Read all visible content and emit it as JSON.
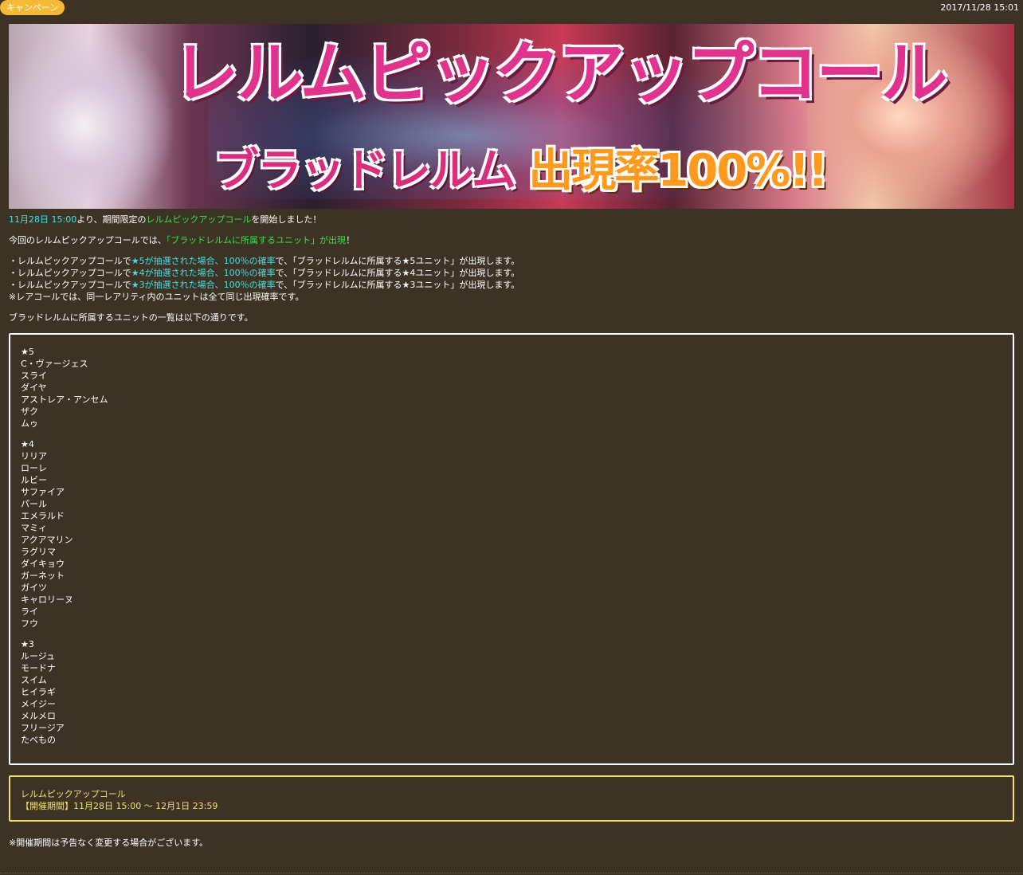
{
  "header": {
    "category": "キャンペーン",
    "date": "2017/11/28 15:01"
  },
  "banner": {
    "title": "レルムピックアップコール",
    "subtitle_main": "ブラッドレルム",
    "subtitle_rate": "出現率100%!!"
  },
  "intro": {
    "start_time": "11月28日 15:00",
    "text_a": "より、期間限定の",
    "event_name": "レルムピックアップコール",
    "text_b": "を開始しました！"
  },
  "highlight": {
    "text_a": "今回のレルムピックアップコールでは、",
    "emphasis": "「ブラッドレルムに所属するユニット」が出現",
    "text_b": "！"
  },
  "rules": [
    {
      "prefix": "・レルムピックアップコールで",
      "em": "★5が抽選された場合、100％の確率",
      "suffix": "で、「ブラッドレルムに所属する★5ユニット」が出現します。"
    },
    {
      "prefix": "・レルムピックアップコールで",
      "em": "★4が抽選された場合、100％の確率",
      "suffix": "で、「ブラッドレルムに所属する★4ユニット」が出現します。"
    },
    {
      "prefix": "・レルムピックアップコールで",
      "em": "★3が抽選された場合、100％の確率",
      "suffix": "で、「ブラッドレルムに所属する★3ユニット」が出現します。"
    }
  ],
  "note_rate": "※レアコールでは、同一レアリティ内のユニットは全て同じ出現確率です。",
  "list_intro": "ブラッドレルムに所属するユニットの一覧は以下の通りです。",
  "unit_groups": [
    {
      "rarity": "★5",
      "units": [
        "C・ヴァージェス",
        "スライ",
        "ダイヤ",
        "アストレア・アンセム",
        "ザク",
        "ムゥ"
      ]
    },
    {
      "rarity": "★4",
      "units": [
        "リリア",
        "ローレ",
        "ルビー",
        "サファイア",
        "パール",
        "エメラルド",
        "マミィ",
        "アクアマリン",
        "ラグリマ",
        "ダイキョウ",
        "ガーネット",
        "ガイツ",
        "キャロリーヌ",
        "ライ",
        "フウ"
      ]
    },
    {
      "rarity": "★3",
      "units": [
        "ルージュ",
        "モードナ",
        "スイム",
        "ヒイラギ",
        "メイジー",
        "メルメロ",
        "フリージア",
        "たべもの"
      ]
    }
  ],
  "period": {
    "name": "レルムピックアップコール",
    "range": "【開催期間】11月28日 15:00 ～ 12月1日 23:59"
  },
  "footnote": "※開催期間は予告なく変更する場合がございます。",
  "colors": {
    "background": "#3d3324",
    "badge": "#f5b935",
    "cyan_text": "#3ee0e8",
    "green_text": "#38e04a",
    "period_border": "#f3e06b"
  }
}
